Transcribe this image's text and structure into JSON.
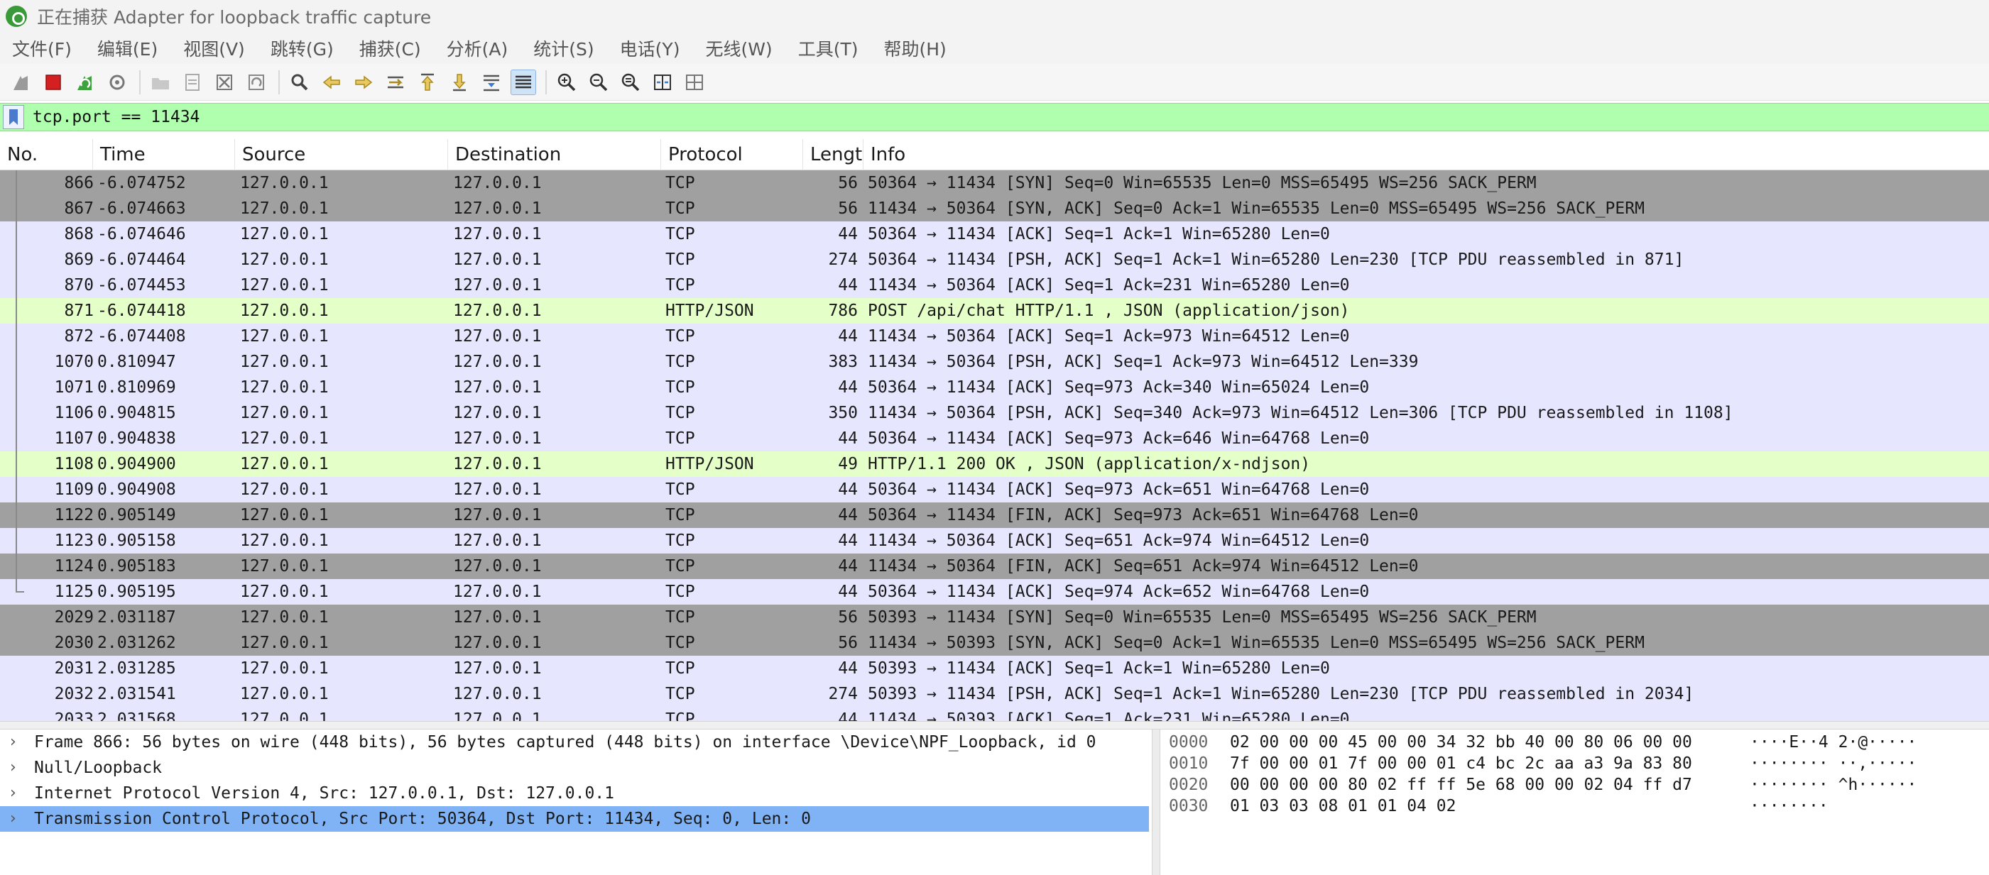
{
  "window": {
    "title": "正在捕获 Adapter for loopback traffic capture"
  },
  "menu": [
    "文件(F)",
    "编辑(E)",
    "视图(V)",
    "跳转(G)",
    "捕获(C)",
    "分析(A)",
    "统计(S)",
    "电话(Y)",
    "无线(W)",
    "工具(T)",
    "帮助(H)"
  ],
  "filter": {
    "value": "tcp.port == 11434"
  },
  "columns": [
    "No.",
    "Time",
    "Source",
    "Destination",
    "Protocol",
    "Lengt",
    "Info"
  ],
  "colors": {
    "tcp_row": "#e7e6ff",
    "syn_fin_row": "#a0a0a0",
    "http_row": "#e4ffc7",
    "selected_detail": "#7fb3f5",
    "filter_bg": "#afffaf"
  },
  "packets": [
    {
      "no": "866",
      "time": "-6.074752",
      "src": "127.0.0.1",
      "dst": "127.0.0.1",
      "proto": "TCP",
      "len": "56",
      "info": "50364 → 11434 [SYN] Seq=0 Win=65535 Len=0 MSS=65495 WS=256 SACK_PERM",
      "style": "syn"
    },
    {
      "no": "867",
      "time": "-6.074663",
      "src": "127.0.0.1",
      "dst": "127.0.0.1",
      "proto": "TCP",
      "len": "56",
      "info": "11434 → 50364 [SYN, ACK] Seq=0 Ack=1 Win=65535 Len=0 MSS=65495 WS=256 SACK_PERM",
      "style": "syn"
    },
    {
      "no": "868",
      "time": "-6.074646",
      "src": "127.0.0.1",
      "dst": "127.0.0.1",
      "proto": "TCP",
      "len": "44",
      "info": "50364 → 11434 [ACK] Seq=1 Ack=1 Win=65280 Len=0",
      "style": "tcp"
    },
    {
      "no": "869",
      "time": "-6.074464",
      "src": "127.0.0.1",
      "dst": "127.0.0.1",
      "proto": "TCP",
      "len": "274",
      "info": "50364 → 11434 [PSH, ACK] Seq=1 Ack=1 Win=65280 Len=230 [TCP PDU reassembled in 871]",
      "style": "tcp"
    },
    {
      "no": "870",
      "time": "-6.074453",
      "src": "127.0.0.1",
      "dst": "127.0.0.1",
      "proto": "TCP",
      "len": "44",
      "info": "11434 → 50364 [ACK] Seq=1 Ack=231 Win=65280 Len=0",
      "style": "tcp"
    },
    {
      "no": "871",
      "time": "-6.074418",
      "src": "127.0.0.1",
      "dst": "127.0.0.1",
      "proto": "HTTP/JSON",
      "len": "786",
      "info": "POST /api/chat HTTP/1.1 , JSON (application/json)",
      "style": "http"
    },
    {
      "no": "872",
      "time": "-6.074408",
      "src": "127.0.0.1",
      "dst": "127.0.0.1",
      "proto": "TCP",
      "len": "44",
      "info": "11434 → 50364 [ACK] Seq=1 Ack=973 Win=64512 Len=0",
      "style": "tcp"
    },
    {
      "no": "1070",
      "time": "0.810947",
      "src": "127.0.0.1",
      "dst": "127.0.0.1",
      "proto": "TCP",
      "len": "383",
      "info": "11434 → 50364 [PSH, ACK] Seq=1 Ack=973 Win=64512 Len=339",
      "style": "tcp"
    },
    {
      "no": "1071",
      "time": "0.810969",
      "src": "127.0.0.1",
      "dst": "127.0.0.1",
      "proto": "TCP",
      "len": "44",
      "info": "50364 → 11434 [ACK] Seq=973 Ack=340 Win=65024 Len=0",
      "style": "tcp"
    },
    {
      "no": "1106",
      "time": "0.904815",
      "src": "127.0.0.1",
      "dst": "127.0.0.1",
      "proto": "TCP",
      "len": "350",
      "info": "11434 → 50364 [PSH, ACK] Seq=340 Ack=973 Win=64512 Len=306 [TCP PDU reassembled in 1108]",
      "style": "tcp"
    },
    {
      "no": "1107",
      "time": "0.904838",
      "src": "127.0.0.1",
      "dst": "127.0.0.1",
      "proto": "TCP",
      "len": "44",
      "info": "50364 → 11434 [ACK] Seq=973 Ack=646 Win=64768 Len=0",
      "style": "tcp"
    },
    {
      "no": "1108",
      "time": "0.904900",
      "src": "127.0.0.1",
      "dst": "127.0.0.1",
      "proto": "HTTP/JSON",
      "len": "49",
      "info": "HTTP/1.1 200 OK , JSON (application/x-ndjson)",
      "style": "http"
    },
    {
      "no": "1109",
      "time": "0.904908",
      "src": "127.0.0.1",
      "dst": "127.0.0.1",
      "proto": "TCP",
      "len": "44",
      "info": "50364 → 11434 [ACK] Seq=973 Ack=651 Win=64768 Len=0",
      "style": "tcp"
    },
    {
      "no": "1122",
      "time": "0.905149",
      "src": "127.0.0.1",
      "dst": "127.0.0.1",
      "proto": "TCP",
      "len": "44",
      "info": "50364 → 11434 [FIN, ACK] Seq=973 Ack=651 Win=64768 Len=0",
      "style": "syn"
    },
    {
      "no": "1123",
      "time": "0.905158",
      "src": "127.0.0.1",
      "dst": "127.0.0.1",
      "proto": "TCP",
      "len": "44",
      "info": "11434 → 50364 [ACK] Seq=651 Ack=974 Win=64512 Len=0",
      "style": "tcp"
    },
    {
      "no": "1124",
      "time": "0.905183",
      "src": "127.0.0.1",
      "dst": "127.0.0.1",
      "proto": "TCP",
      "len": "44",
      "info": "11434 → 50364 [FIN, ACK] Seq=651 Ack=974 Win=64512 Len=0",
      "style": "syn"
    },
    {
      "no": "1125",
      "time": "0.905195",
      "src": "127.0.0.1",
      "dst": "127.0.0.1",
      "proto": "TCP",
      "len": "44",
      "info": "50364 → 11434 [ACK] Seq=974 Ack=652 Win=64768 Len=0",
      "style": "tcp"
    },
    {
      "no": "2029",
      "time": "2.031187",
      "src": "127.0.0.1",
      "dst": "127.0.0.1",
      "proto": "TCP",
      "len": "56",
      "info": "50393 → 11434 [SYN] Seq=0 Win=65535 Len=0 MSS=65495 WS=256 SACK_PERM",
      "style": "syn"
    },
    {
      "no": "2030",
      "time": "2.031262",
      "src": "127.0.0.1",
      "dst": "127.0.0.1",
      "proto": "TCP",
      "len": "56",
      "info": "11434 → 50393 [SYN, ACK] Seq=0 Ack=1 Win=65535 Len=0 MSS=65495 WS=256 SACK_PERM",
      "style": "syn"
    },
    {
      "no": "2031",
      "time": "2.031285",
      "src": "127.0.0.1",
      "dst": "127.0.0.1",
      "proto": "TCP",
      "len": "44",
      "info": "50393 → 11434 [ACK] Seq=1 Ack=1 Win=65280 Len=0",
      "style": "tcp"
    },
    {
      "no": "2032",
      "time": "2.031541",
      "src": "127.0.0.1",
      "dst": "127.0.0.1",
      "proto": "TCP",
      "len": "274",
      "info": "50393 → 11434 [PSH, ACK] Seq=1 Ack=1 Win=65280 Len=230 [TCP PDU reassembled in 2034]",
      "style": "tcp"
    },
    {
      "no": "2033",
      "time": "2.031568",
      "src": "127.0.0.1",
      "dst": "127.0.0.1",
      "proto": "TCP",
      "len": "44",
      "info": "11434 → 50393 [ACK] Seq=1 Ack=231 Win=65280 Len=0",
      "style": "tcp"
    }
  ],
  "details": [
    {
      "text": "Frame 866: 56 bytes on wire (448 bits), 56 bytes captured (448 bits) on interface \\Device\\NPF_Loopback, id 0",
      "selected": false
    },
    {
      "text": "Null/Loopback",
      "selected": false
    },
    {
      "text": "Internet Protocol Version 4, Src: 127.0.0.1, Dst: 127.0.0.1",
      "selected": false
    },
    {
      "text": "Transmission Control Protocol, Src Port: 50364, Dst Port: 11434, Seq: 0, Len: 0",
      "selected": true
    }
  ],
  "bytes": [
    {
      "offset": "0000",
      "hex": "02 00 00 00 45 00 00 34  32 bb 40 00 80 06 00 00",
      "ascii": "····E··4 2·@·····"
    },
    {
      "offset": "0010",
      "hex": "7f 00 00 01 7f 00 00 01  c4 bc 2c aa a3 9a 83 80",
      "ascii": "········ ··,·····"
    },
    {
      "offset": "0020",
      "hex": "00 00 00 00 80 02 ff ff  5e 68 00 00 02 04 ff d7",
      "ascii": "········ ^h······"
    },
    {
      "offset": "0030",
      "hex": "01 03 03 08 01 01 04 02",
      "ascii": "········"
    }
  ]
}
